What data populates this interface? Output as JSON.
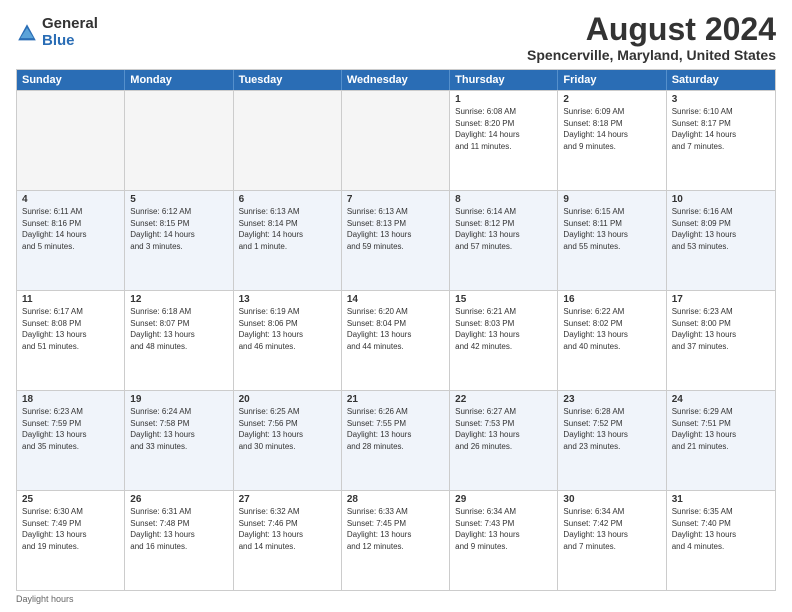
{
  "logo": {
    "general": "General",
    "blue": "Blue"
  },
  "title": "August 2024",
  "subtitle": "Spencerville, Maryland, United States",
  "header_days": [
    "Sunday",
    "Monday",
    "Tuesday",
    "Wednesday",
    "Thursday",
    "Friday",
    "Saturday"
  ],
  "footer": "Daylight hours",
  "rows": [
    {
      "alt": false,
      "cells": [
        {
          "day": "",
          "info": "",
          "empty": true
        },
        {
          "day": "",
          "info": "",
          "empty": true
        },
        {
          "day": "",
          "info": "",
          "empty": true
        },
        {
          "day": "",
          "info": "",
          "empty": true
        },
        {
          "day": "1",
          "info": "Sunrise: 6:08 AM\nSunset: 8:20 PM\nDaylight: 14 hours\nand 11 minutes.",
          "empty": false
        },
        {
          "day": "2",
          "info": "Sunrise: 6:09 AM\nSunset: 8:18 PM\nDaylight: 14 hours\nand 9 minutes.",
          "empty": false
        },
        {
          "day": "3",
          "info": "Sunrise: 6:10 AM\nSunset: 8:17 PM\nDaylight: 14 hours\nand 7 minutes.",
          "empty": false
        }
      ]
    },
    {
      "alt": true,
      "cells": [
        {
          "day": "4",
          "info": "Sunrise: 6:11 AM\nSunset: 8:16 PM\nDaylight: 14 hours\nand 5 minutes.",
          "empty": false
        },
        {
          "day": "5",
          "info": "Sunrise: 6:12 AM\nSunset: 8:15 PM\nDaylight: 14 hours\nand 3 minutes.",
          "empty": false
        },
        {
          "day": "6",
          "info": "Sunrise: 6:13 AM\nSunset: 8:14 PM\nDaylight: 14 hours\nand 1 minute.",
          "empty": false
        },
        {
          "day": "7",
          "info": "Sunrise: 6:13 AM\nSunset: 8:13 PM\nDaylight: 13 hours\nand 59 minutes.",
          "empty": false
        },
        {
          "day": "8",
          "info": "Sunrise: 6:14 AM\nSunset: 8:12 PM\nDaylight: 13 hours\nand 57 minutes.",
          "empty": false
        },
        {
          "day": "9",
          "info": "Sunrise: 6:15 AM\nSunset: 8:11 PM\nDaylight: 13 hours\nand 55 minutes.",
          "empty": false
        },
        {
          "day": "10",
          "info": "Sunrise: 6:16 AM\nSunset: 8:09 PM\nDaylight: 13 hours\nand 53 minutes.",
          "empty": false
        }
      ]
    },
    {
      "alt": false,
      "cells": [
        {
          "day": "11",
          "info": "Sunrise: 6:17 AM\nSunset: 8:08 PM\nDaylight: 13 hours\nand 51 minutes.",
          "empty": false
        },
        {
          "day": "12",
          "info": "Sunrise: 6:18 AM\nSunset: 8:07 PM\nDaylight: 13 hours\nand 48 minutes.",
          "empty": false
        },
        {
          "day": "13",
          "info": "Sunrise: 6:19 AM\nSunset: 8:06 PM\nDaylight: 13 hours\nand 46 minutes.",
          "empty": false
        },
        {
          "day": "14",
          "info": "Sunrise: 6:20 AM\nSunset: 8:04 PM\nDaylight: 13 hours\nand 44 minutes.",
          "empty": false
        },
        {
          "day": "15",
          "info": "Sunrise: 6:21 AM\nSunset: 8:03 PM\nDaylight: 13 hours\nand 42 minutes.",
          "empty": false
        },
        {
          "day": "16",
          "info": "Sunrise: 6:22 AM\nSunset: 8:02 PM\nDaylight: 13 hours\nand 40 minutes.",
          "empty": false
        },
        {
          "day": "17",
          "info": "Sunrise: 6:23 AM\nSunset: 8:00 PM\nDaylight: 13 hours\nand 37 minutes.",
          "empty": false
        }
      ]
    },
    {
      "alt": true,
      "cells": [
        {
          "day": "18",
          "info": "Sunrise: 6:23 AM\nSunset: 7:59 PM\nDaylight: 13 hours\nand 35 minutes.",
          "empty": false
        },
        {
          "day": "19",
          "info": "Sunrise: 6:24 AM\nSunset: 7:58 PM\nDaylight: 13 hours\nand 33 minutes.",
          "empty": false
        },
        {
          "day": "20",
          "info": "Sunrise: 6:25 AM\nSunset: 7:56 PM\nDaylight: 13 hours\nand 30 minutes.",
          "empty": false
        },
        {
          "day": "21",
          "info": "Sunrise: 6:26 AM\nSunset: 7:55 PM\nDaylight: 13 hours\nand 28 minutes.",
          "empty": false
        },
        {
          "day": "22",
          "info": "Sunrise: 6:27 AM\nSunset: 7:53 PM\nDaylight: 13 hours\nand 26 minutes.",
          "empty": false
        },
        {
          "day": "23",
          "info": "Sunrise: 6:28 AM\nSunset: 7:52 PM\nDaylight: 13 hours\nand 23 minutes.",
          "empty": false
        },
        {
          "day": "24",
          "info": "Sunrise: 6:29 AM\nSunset: 7:51 PM\nDaylight: 13 hours\nand 21 minutes.",
          "empty": false
        }
      ]
    },
    {
      "alt": false,
      "cells": [
        {
          "day": "25",
          "info": "Sunrise: 6:30 AM\nSunset: 7:49 PM\nDaylight: 13 hours\nand 19 minutes.",
          "empty": false
        },
        {
          "day": "26",
          "info": "Sunrise: 6:31 AM\nSunset: 7:48 PM\nDaylight: 13 hours\nand 16 minutes.",
          "empty": false
        },
        {
          "day": "27",
          "info": "Sunrise: 6:32 AM\nSunset: 7:46 PM\nDaylight: 13 hours\nand 14 minutes.",
          "empty": false
        },
        {
          "day": "28",
          "info": "Sunrise: 6:33 AM\nSunset: 7:45 PM\nDaylight: 13 hours\nand 12 minutes.",
          "empty": false
        },
        {
          "day": "29",
          "info": "Sunrise: 6:34 AM\nSunset: 7:43 PM\nDaylight: 13 hours\nand 9 minutes.",
          "empty": false
        },
        {
          "day": "30",
          "info": "Sunrise: 6:34 AM\nSunset: 7:42 PM\nDaylight: 13 hours\nand 7 minutes.",
          "empty": false
        },
        {
          "day": "31",
          "info": "Sunrise: 6:35 AM\nSunset: 7:40 PM\nDaylight: 13 hours\nand 4 minutes.",
          "empty": false
        }
      ]
    }
  ]
}
